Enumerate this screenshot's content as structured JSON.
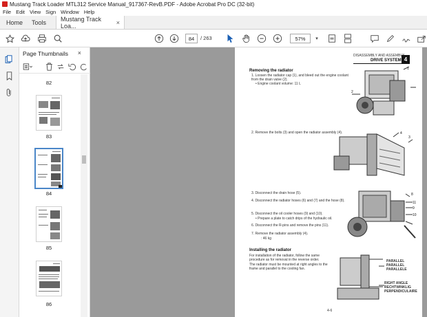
{
  "window": {
    "title": "Mustang Track Loader MTL312 Service Manual_917367-RevB.PDF - Adobe Acrobat Pro DC (32-bit)"
  },
  "menu": [
    "File",
    "Edit",
    "View",
    "Sign",
    "Window",
    "Help"
  ],
  "tabs": {
    "home": "Home",
    "tools": "Tools",
    "doc": "Mustang Track Loa...",
    "doc_close": "×"
  },
  "toolbar": {
    "page_current": "84",
    "page_total": "/ 263",
    "zoom": "57%"
  },
  "panel": {
    "title": "Page Thumbnails",
    "close": "×",
    "thumbs": [
      {
        "label": "82"
      },
      {
        "label": "83"
      },
      {
        "label": "84"
      },
      {
        "label": "85"
      },
      {
        "label": "86"
      }
    ]
  },
  "document": {
    "header_small": "DISASSEMBLY AND ASSEMBLY",
    "header_title": "DRIVE SYSTEM",
    "header_num": "4",
    "section1": "Removing the radiator",
    "step1": "1.  Loosen the radiator cap (1), and bleed out the engine coolant from the drain valve (2).",
    "step1b": "• Engine coolant volume: 11 L",
    "step2": "2.  Remove the bolts (3) and open the radiator assembly (4).",
    "step3": "3.  Disconnect the drain hose (5).",
    "step4": "4.  Disconnect the radiator hoses (6) and (7) and the hose (8).",
    "step5": "5.  Disconnect the oil cooler hoses (9) and (10).",
    "step5b": "• Prepare a plate to catch drips of the hydraulic oil.",
    "step6": "6.  Disconnect the R-pins and remove the pins (11).",
    "step7": "7.  Remove the radiator assembly (4).",
    "step7b": ": 46 kg",
    "section2": "Installing the radiator",
    "install_text": "For installation of the radiator, follow the same procedure as for removal in the reverse order.",
    "install_text2": "The radiator must be mounted at right angles to the frame and parallel to the cooling fan.",
    "fig_label1": "PARALLEL",
    "fig_label2": "PARALLEL",
    "fig_label3": "PARALLELE",
    "fig_label4": "RIGHT ANGLE",
    "fig_label5": "RECHTWINKLIG",
    "fig_label6": "PERPENDICULAIRE",
    "page_num": "4-6"
  },
  "colors": {
    "accent": "#4a86c8",
    "viewer_bg": "#9a9a9a",
    "acrobat_red": "#d4211c"
  }
}
